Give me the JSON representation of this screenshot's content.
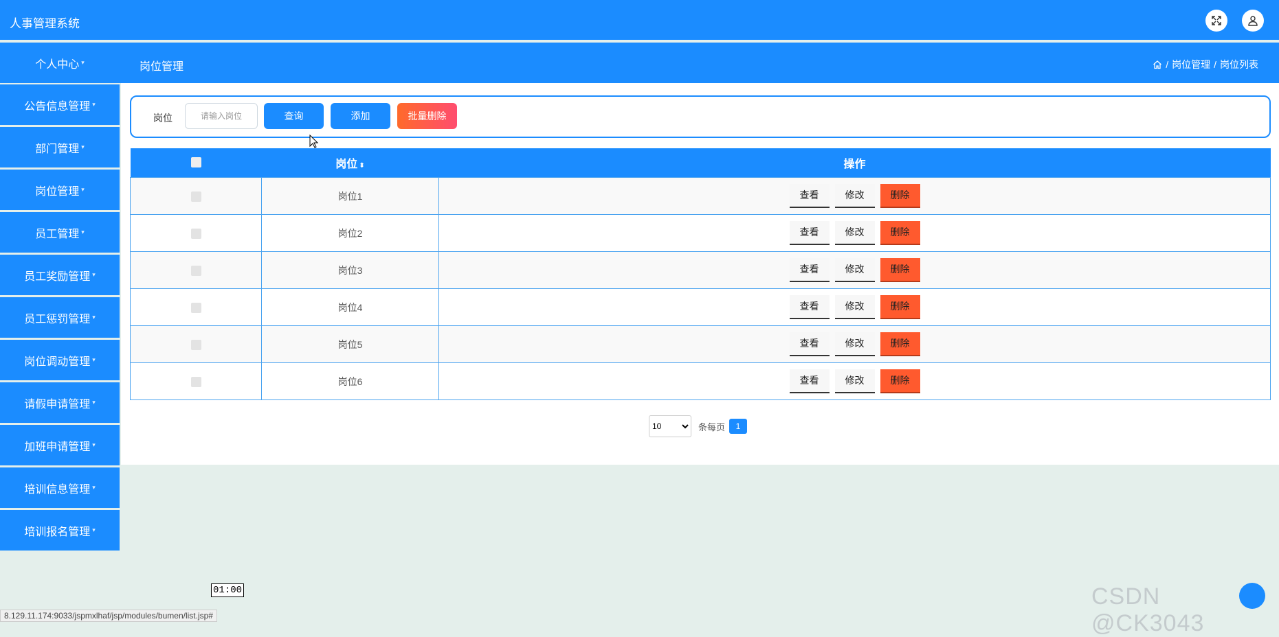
{
  "app": {
    "title": "人事管理系统"
  },
  "header_icons": {
    "fullscreen": "fullscreen-icon",
    "user": "user-icon"
  },
  "subheader": {
    "menu_top": "个人中心",
    "page_title": "岗位管理",
    "breadcrumb": [
      "岗位管理",
      "岗位列表"
    ],
    "separator": "/"
  },
  "sidebar": {
    "items": [
      {
        "label": "公告信息管理"
      },
      {
        "label": "部门管理"
      },
      {
        "label": "岗位管理"
      },
      {
        "label": "员工管理"
      },
      {
        "label": "员工奖励管理"
      },
      {
        "label": "员工惩罚管理"
      },
      {
        "label": "岗位调动管理"
      },
      {
        "label": "请假申请管理"
      },
      {
        "label": "加班申请管理"
      },
      {
        "label": "培训信息管理"
      },
      {
        "label": "培训报名管理"
      }
    ]
  },
  "search": {
    "label": "岗位",
    "placeholder": "请输入岗位",
    "query_label": "查询",
    "add_label": "添加",
    "batch_delete_label": "批量删除"
  },
  "table": {
    "headers": {
      "position": "岗位",
      "actions": "操作"
    },
    "actions": {
      "view": "查看",
      "edit": "修改",
      "delete": "删除"
    },
    "rows": [
      {
        "position": "岗位1"
      },
      {
        "position": "岗位2"
      },
      {
        "position": "岗位3"
      },
      {
        "position": "岗位4"
      },
      {
        "position": "岗位5"
      },
      {
        "position": "岗位6"
      }
    ]
  },
  "pagination": {
    "page_size": "10",
    "page_size_options": [
      "10"
    ],
    "per_page_label": "条每页",
    "current_page": "1"
  },
  "overlay": {
    "time": "01:00",
    "status_url": "8.129.11.174:9033/jspmxlhaf/jsp/modules/bumen/list.jsp#",
    "watermark": "CSDN @CK3043"
  },
  "colors": {
    "primary": "#1b8cff",
    "danger": "#ff5a2e",
    "background": "#e4efeb"
  }
}
